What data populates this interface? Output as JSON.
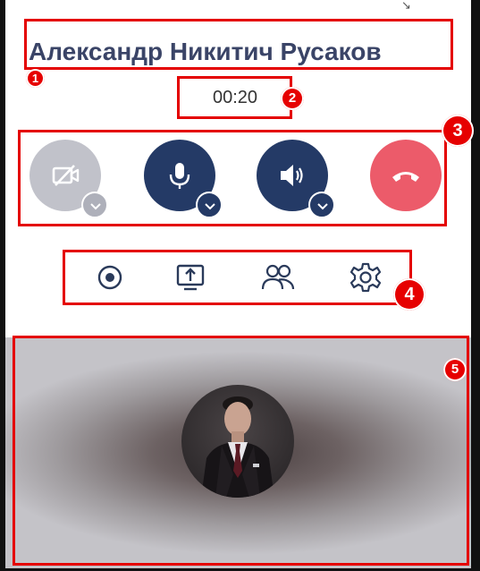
{
  "call": {
    "caller_name": "Александр Никитич Русаков",
    "duration": "00:20"
  },
  "controls": [
    {
      "name": "camera-off",
      "icon": "camera-off-icon",
      "has_dropdown": true,
      "state": "disabled",
      "color": "#c1c2ca"
    },
    {
      "name": "microphone",
      "icon": "microphone-icon",
      "has_dropdown": true,
      "state": "on",
      "color": "#243a66"
    },
    {
      "name": "speaker",
      "icon": "speaker-icon",
      "has_dropdown": true,
      "state": "on",
      "color": "#243a66"
    },
    {
      "name": "hang-up",
      "icon": "phone-hangup-icon",
      "has_dropdown": false,
      "state": "active",
      "color": "#ec5b6a"
    }
  ],
  "tools": [
    {
      "name": "record",
      "icon": "record-icon"
    },
    {
      "name": "screen-share",
      "icon": "screen-share-icon"
    },
    {
      "name": "participants",
      "icon": "participants-icon"
    },
    {
      "name": "settings",
      "icon": "gear-icon"
    }
  ],
  "annotations": [
    "1",
    "2",
    "3",
    "4",
    "5"
  ],
  "colors": {
    "name_text": "#3a4467",
    "annotation_red": "#e40000",
    "control_dark": "#243a66",
    "hangup_red": "#ec5b6a",
    "disabled_grey": "#c1c2ca",
    "tool_icon": "#2a3a5a"
  }
}
